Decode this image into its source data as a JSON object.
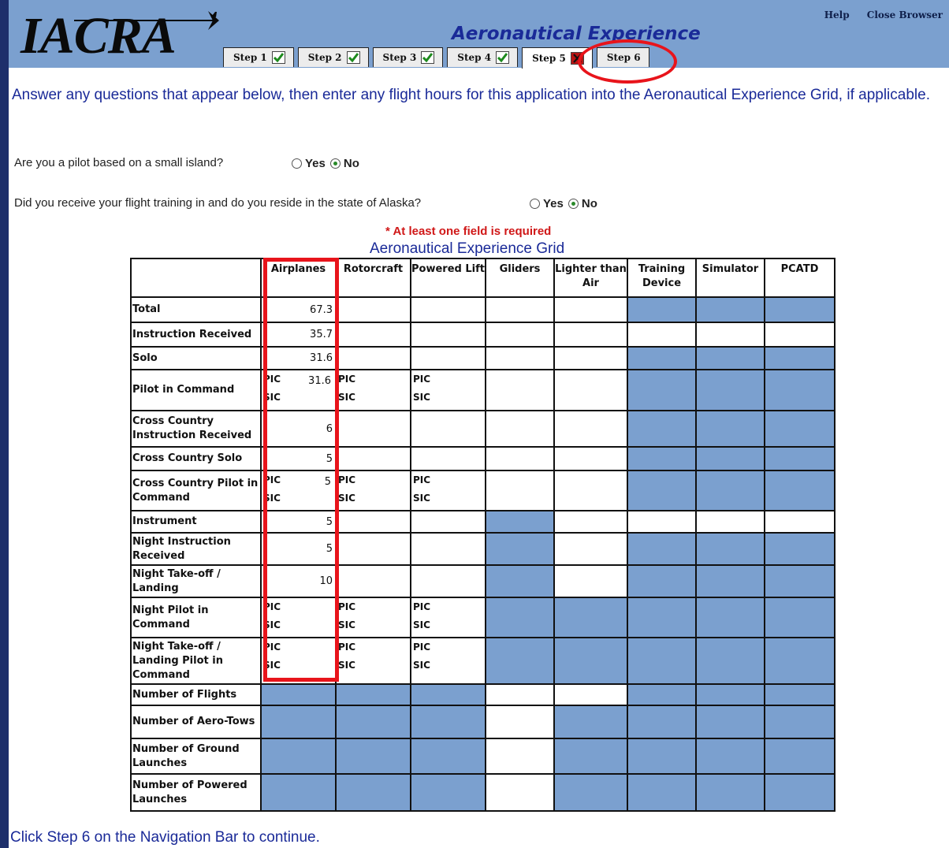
{
  "header": {
    "logo_text": "IACRA",
    "page_heading": "Aeronautical Experience",
    "links": [
      "Help",
      "Close Browser"
    ],
    "tabs": [
      {
        "label": "Step 1",
        "status": "complete"
      },
      {
        "label": "Step 2",
        "status": "complete"
      },
      {
        "label": "Step 3",
        "status": "complete"
      },
      {
        "label": "Step 4",
        "status": "complete"
      },
      {
        "label": "Step 5",
        "status": "incomplete"
      },
      {
        "label": "Step 6",
        "status": "none"
      }
    ],
    "active_tab": "Step 5"
  },
  "instructions": "Answer any questions that appear below, then enter any flight hours for this application into the Aeronautical Experience Grid, if applicable.",
  "questions": [
    {
      "text": "Are you a pilot based on a small island?",
      "options": [
        "Yes",
        "No"
      ],
      "selected": "No"
    },
    {
      "text": "Did you receive your flight training in and do you reside in the state of Alaska?",
      "options": [
        "Yes",
        "No"
      ],
      "selected": "No"
    }
  ],
  "required_note": "* At least one field is required",
  "grid": {
    "title": "Aeronautical Experience Grid",
    "columns": [
      "Airplanes",
      "Rotorcraft",
      "Powered Lift",
      "Gliders",
      "Lighter than Air",
      "Training Device",
      "Simulator",
      "PCATD"
    ],
    "pic_label": "PIC",
    "sic_label": "SIC",
    "rows": [
      {
        "label": "Total",
        "airplanes": "67.3"
      },
      {
        "label": "Instruction Received",
        "airplanes": "35.7"
      },
      {
        "label": "Solo",
        "airplanes": "31.6"
      },
      {
        "label": "Pilot in Command",
        "airplanes": "31.6"
      },
      {
        "label": "Cross Country Instruction Received",
        "airplanes": "6"
      },
      {
        "label": "Cross Country Solo",
        "airplanes": "5"
      },
      {
        "label": "Cross Country Pilot in Command",
        "airplanes": "5"
      },
      {
        "label": "Instrument",
        "airplanes": "5"
      },
      {
        "label": "Night Instruction Received",
        "airplanes": "5"
      },
      {
        "label": "Night Take-off / Landing",
        "airplanes": "10"
      },
      {
        "label": "Night Pilot in Command",
        "airplanes": ""
      },
      {
        "label": "Night Take-off / Landing Pilot in Command",
        "airplanes": ""
      },
      {
        "label": "Number of Flights"
      },
      {
        "label": "Number of Aero-Tows"
      },
      {
        "label": "Number of Ground Launches"
      },
      {
        "label": "Number of Powered Launches"
      }
    ]
  },
  "footer": "Click Step 6 on the Navigation Bar to continue.",
  "colors": {
    "header_bg": "#7ba0cf",
    "heading": "#1a2a98",
    "highlight": "#e8141b",
    "frame": "#1e2f6b"
  }
}
